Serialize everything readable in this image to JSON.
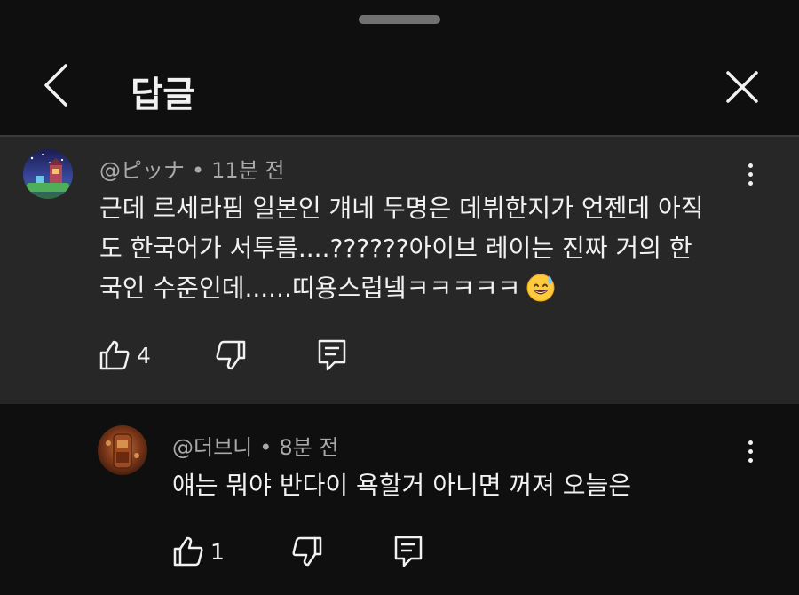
{
  "header": {
    "title": "답글",
    "back_icon": "chevron-left-icon",
    "close_icon": "close-icon"
  },
  "parent_comment": {
    "handle": "@ピッナ",
    "time": "11분 전",
    "lines": [
      "근데 르세라핌 일본인 걔네 두명은 데뷔한지가 언젠데 아직",
      "도 한국어가 서투름....??????아이브 레이는 진짜 거의 한",
      "국인 수준인데......띠용스럽넼ㅋㅋㅋㅋㅋ"
    ],
    "emoji": "grinning-face-with-sweat",
    "likes": "4"
  },
  "reply": {
    "handle": "@더브니",
    "time": "8분 전",
    "text": "얘는 뭐야 반다이 욕할거 아니면 꺼져 오늘은",
    "likes": "1"
  },
  "separator": "•",
  "colors": {
    "background": "#0f0f0f",
    "highlight": "#272727",
    "text": "#f1f1f1",
    "meta": "#aaaaaa"
  }
}
